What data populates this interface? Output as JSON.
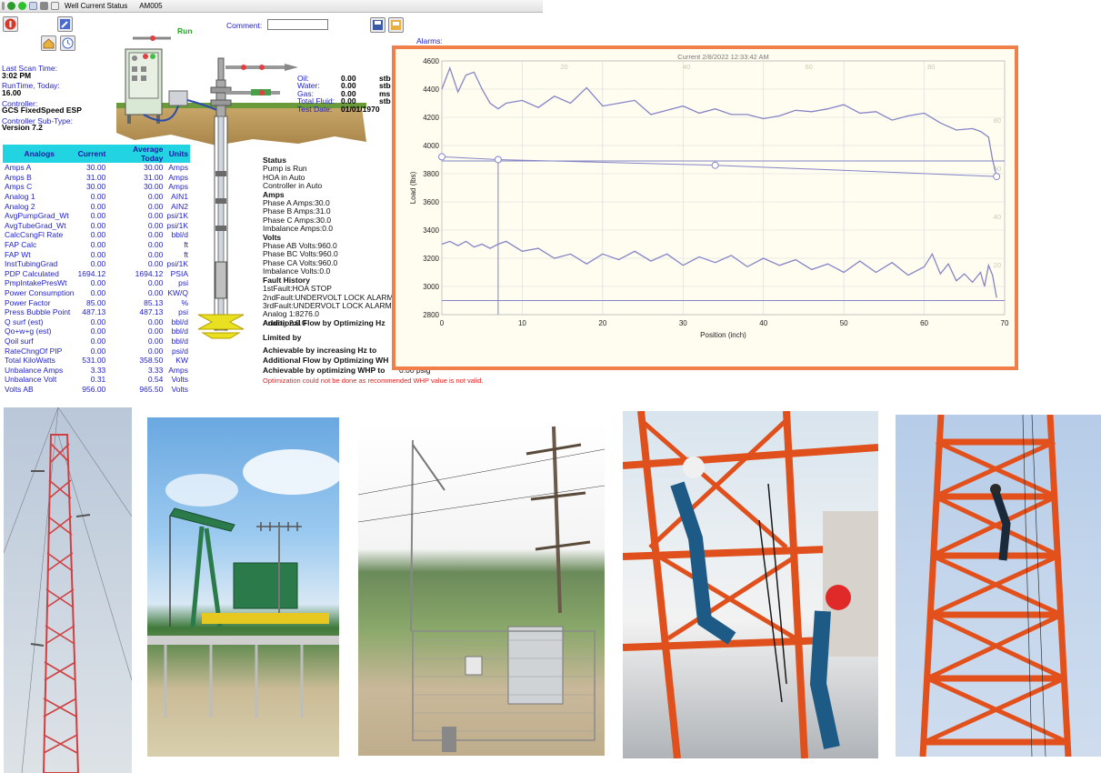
{
  "toolbar": {
    "title": "Well Current Status",
    "well_id": "AM005"
  },
  "header": {
    "run_label": "Run",
    "comment_label": "Comment:",
    "comment_value": "",
    "alarms_label": "Alarms:"
  },
  "left_info": {
    "last_scan_label": "Last Scan Time:",
    "last_scan_value": "3:02 PM",
    "runtime_label": "RunTime, Today:",
    "runtime_value": "16.00",
    "controller_label": "Controller:",
    "controller_value": "GCS FixedSpeed ESP",
    "subtype_label": "Controller Sub-Type:",
    "subtype_value": "Version 7.2"
  },
  "flow": {
    "rows": [
      {
        "label": "Oil:",
        "value": "0.00",
        "unit": "stb"
      },
      {
        "label": "Water:",
        "value": "0.00",
        "unit": "stb"
      },
      {
        "label": "Gas:",
        "value": "0.00",
        "unit": "ms"
      },
      {
        "label": "Total Fluid:",
        "value": "0.00",
        "unit": "stb"
      },
      {
        "label": "Test Date:",
        "value": "01/01/1970",
        "unit": ""
      }
    ]
  },
  "analogs": {
    "headers": [
      "Analogs",
      "Current",
      "Average Today",
      "Units"
    ],
    "rows": [
      [
        "Amps A",
        "30.00",
        "30.00",
        "Amps"
      ],
      [
        "Amps B",
        "31.00",
        "31.00",
        "Amps"
      ],
      [
        "Amps C",
        "30.00",
        "30.00",
        "Amps"
      ],
      [
        "Analog 1",
        "0.00",
        "0.00",
        "AIN1"
      ],
      [
        "Analog 2",
        "0.00",
        "0.00",
        "AIN2"
      ],
      [
        "AvgPumpGrad_Wt",
        "0.00",
        "0.00",
        "psi/1K"
      ],
      [
        "AvgTubeGrad_Wt",
        "0.00",
        "0.00",
        "psi/1K"
      ],
      [
        "CalcCsngFl Rate",
        "0.00",
        "0.00",
        "bbl/d"
      ],
      [
        "FAP Calc",
        "0.00",
        "0.00",
        "ft"
      ],
      [
        "FAP Wt",
        "0.00",
        "0.00",
        "ft"
      ],
      [
        "InstTubingGrad",
        "0.00",
        "0.00",
        "psi/1K"
      ],
      [
        "PDP Calculated",
        "1694.12",
        "1694.12",
        "PSIA"
      ],
      [
        "PmpIntakePresWt",
        "0.00",
        "0.00",
        "psi"
      ],
      [
        "Power Consumption",
        "0.00",
        "0.00",
        "KW/Q"
      ],
      [
        "Power Factor",
        "85.00",
        "85.13",
        "%"
      ],
      [
        "Press Bubble Point",
        "487.13",
        "487.13",
        "psi"
      ],
      [
        "Q surf (est)",
        "0.00",
        "0.00",
        "bbl/d"
      ],
      [
        "Qo+w+g (est)",
        "0.00",
        "0.00",
        "bbl/d"
      ],
      [
        "Qoil surf",
        "0.00",
        "0.00",
        "bbl/d"
      ],
      [
        "RateChngOf PIP",
        "0.00",
        "0.00",
        "psi/d"
      ],
      [
        "Total KiloWatts",
        "531.00",
        "358.50",
        "KW"
      ],
      [
        "Unbalance Amps",
        "3.33",
        "3.33",
        "Amps"
      ],
      [
        "Unbalance Volt",
        "0.31",
        "0.54",
        "Volts"
      ],
      [
        "Volts AB",
        "956.00",
        "965.50",
        "Volts"
      ]
    ]
  },
  "status": {
    "title": "Status",
    "lines": [
      "Pump is Run",
      "HOA in Auto",
      "Controller in Auto"
    ],
    "amps_title": "Amps",
    "amps_lines": [
      "Phase A Amps:30.0",
      "Phase B Amps:31.0",
      "Phase C Amps:30.0",
      "Imbalance Amps:0.0"
    ],
    "volts_title": "Volts",
    "volts_lines": [
      "Phase AB Volts:960.0",
      "Phase BC Volts:960.0",
      "Phase CA Volts:960.0",
      "Imbalance Volts:0.0"
    ],
    "fault_title": "Fault History",
    "fault_lines": [
      "1stFault:HOA STOP",
      "2ndFault:UNDERVOLT LOCK ALARM",
      "3rdFault:UNDERVOLT LOCK ALARM",
      "Analog 1:8276.0",
      "Analog 2:0.0"
    ],
    "add_flow_hz": "Additional Flow by Optimizing Hz",
    "limited_by": "Limited by",
    "achievable_hz": "Achievable by increasing Hz to",
    "add_flow_whp": "Additional Flow by Optimizing WH",
    "achievable_whp": "Achievable by optimizing WHP to",
    "achievable_whp_value": "0.00 psig",
    "error": "Optimization could not be done as recommended WHP value is not valid."
  },
  "colors": {
    "run": "#22aa22",
    "link": "#1f1fc8",
    "chart_line": "#8585c8",
    "frame": "#f07f4a",
    "error": "#e02020"
  },
  "chart_data": {
    "type": "line",
    "subtitle": "Current   2/8/2022 12:33:42 AM",
    "xlabel": "Position (inch)",
    "ylabel": "Load (lbs)",
    "xlim": [
      0,
      70
    ],
    "ylim": [
      2800,
      4600
    ],
    "xticks": [
      0,
      10,
      20,
      30,
      40,
      50,
      60,
      70
    ],
    "yticks": [
      2800,
      3000,
      3200,
      3400,
      3600,
      3800,
      4000,
      4200,
      4400,
      4600
    ],
    "top_ticks": [
      "20",
      "40",
      "60",
      "80"
    ],
    "right_ticks": [
      "80",
      "60",
      "40",
      "20"
    ],
    "upper": {
      "x": [
        0,
        1,
        2,
        3,
        4,
        5,
        6,
        7,
        8,
        10,
        12,
        14,
        16,
        18,
        20,
        22,
        24,
        26,
        28,
        30,
        32,
        34,
        36,
        38,
        40,
        42,
        44,
        46,
        48,
        50,
        52,
        54,
        56,
        58,
        60,
        62,
        64,
        66,
        67,
        68,
        68.5,
        69
      ],
      "y": [
        4400,
        4550,
        4380,
        4500,
        4520,
        4400,
        4300,
        4260,
        4300,
        4320,
        4270,
        4350,
        4300,
        4410,
        4280,
        4300,
        4320,
        4220,
        4250,
        4280,
        4230,
        4260,
        4220,
        4220,
        4190,
        4210,
        4250,
        4240,
        4260,
        4290,
        4230,
        4240,
        4180,
        4210,
        4230,
        4160,
        4110,
        4120,
        4100,
        4060,
        3900,
        3780
      ]
    },
    "lower": {
      "x": [
        0,
        1,
        2,
        3,
        4,
        5,
        6,
        7,
        8,
        10,
        12,
        14,
        16,
        18,
        20,
        22,
        24,
        26,
        28,
        30,
        32,
        34,
        36,
        38,
        40,
        42,
        44,
        46,
        48,
        50,
        52,
        54,
        56,
        58,
        60,
        61,
        62,
        63,
        64,
        65,
        66,
        67,
        67.5,
        68,
        68.5,
        69
      ],
      "y": [
        3300,
        3320,
        3290,
        3320,
        3280,
        3300,
        3270,
        3300,
        3320,
        3250,
        3270,
        3200,
        3230,
        3160,
        3230,
        3190,
        3250,
        3180,
        3230,
        3150,
        3210,
        3170,
        3220,
        3140,
        3200,
        3150,
        3190,
        3120,
        3160,
        3100,
        3180,
        3100,
        3170,
        3080,
        3140,
        3230,
        3090,
        3160,
        3040,
        3090,
        3030,
        3100,
        3000,
        3150,
        3080,
        2920
      ]
    },
    "secondary": {
      "x": [
        0,
        7,
        34,
        69
      ],
      "y": [
        3920,
        3900,
        3860,
        3780
      ]
    },
    "hline_y": 3890,
    "vline_x": 7
  }
}
